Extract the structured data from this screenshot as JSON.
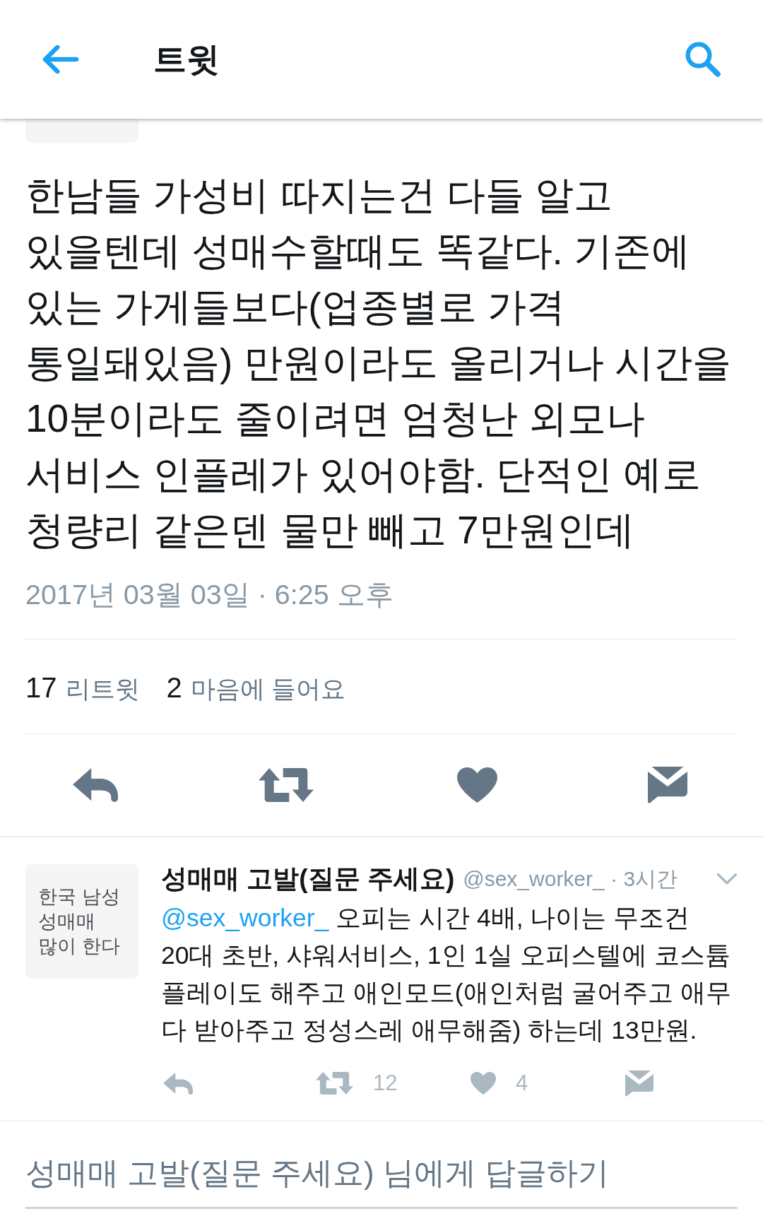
{
  "top_bar": {
    "title": "트윗"
  },
  "tweet": {
    "text": "한남들 가성비 따지는건 다들 알고 있을텐데 성매수할때도 똑같다. 기존에 있는 가게들보다(업종별로 가격 통일돼있음) 만원이라도 올리거나 시간을 10분이라도 줄이려면 엄청난 외모나 서비스 인플레가 있어야함. 단적인 예로 청량리 같은덴 물만 빼고 7만원인데",
    "timestamp": "2017년 03월 03일 · 6:25 오후",
    "stats": [
      {
        "count": "17",
        "label": "리트윗"
      },
      {
        "count": "2",
        "label": "마음에 들어요"
      }
    ],
    "actions": [
      {
        "kind": "reply"
      },
      {
        "kind": "retweet"
      },
      {
        "kind": "like"
      },
      {
        "kind": "message"
      }
    ]
  },
  "reply": {
    "avatar_text": "한국 남성\n성매매\n많이 한다",
    "name": "성매매 고발(질문 주세요)",
    "meta": "@sex_worker_ · 3시간",
    "mention": "@sex_worker_",
    "text": "오피는 시간 4배, 나이는 무조건 20대 초반, 샤워서비스, 1인 1실 오피스텔에 코스튬 플레이도 해주고 애인모드(애인처럼 굴어주고 애무 다 받아주고 정성스레 애무해줌) 하는데 13만원.",
    "actions": [
      {
        "kind": "reply"
      },
      {
        "kind": "retweet",
        "count": "12"
      },
      {
        "kind": "like",
        "count": "4"
      },
      {
        "kind": "message"
      }
    ]
  },
  "compose": {
    "placeholder": "성매매 고발(질문 주세요) 님에게 답글하기"
  }
}
